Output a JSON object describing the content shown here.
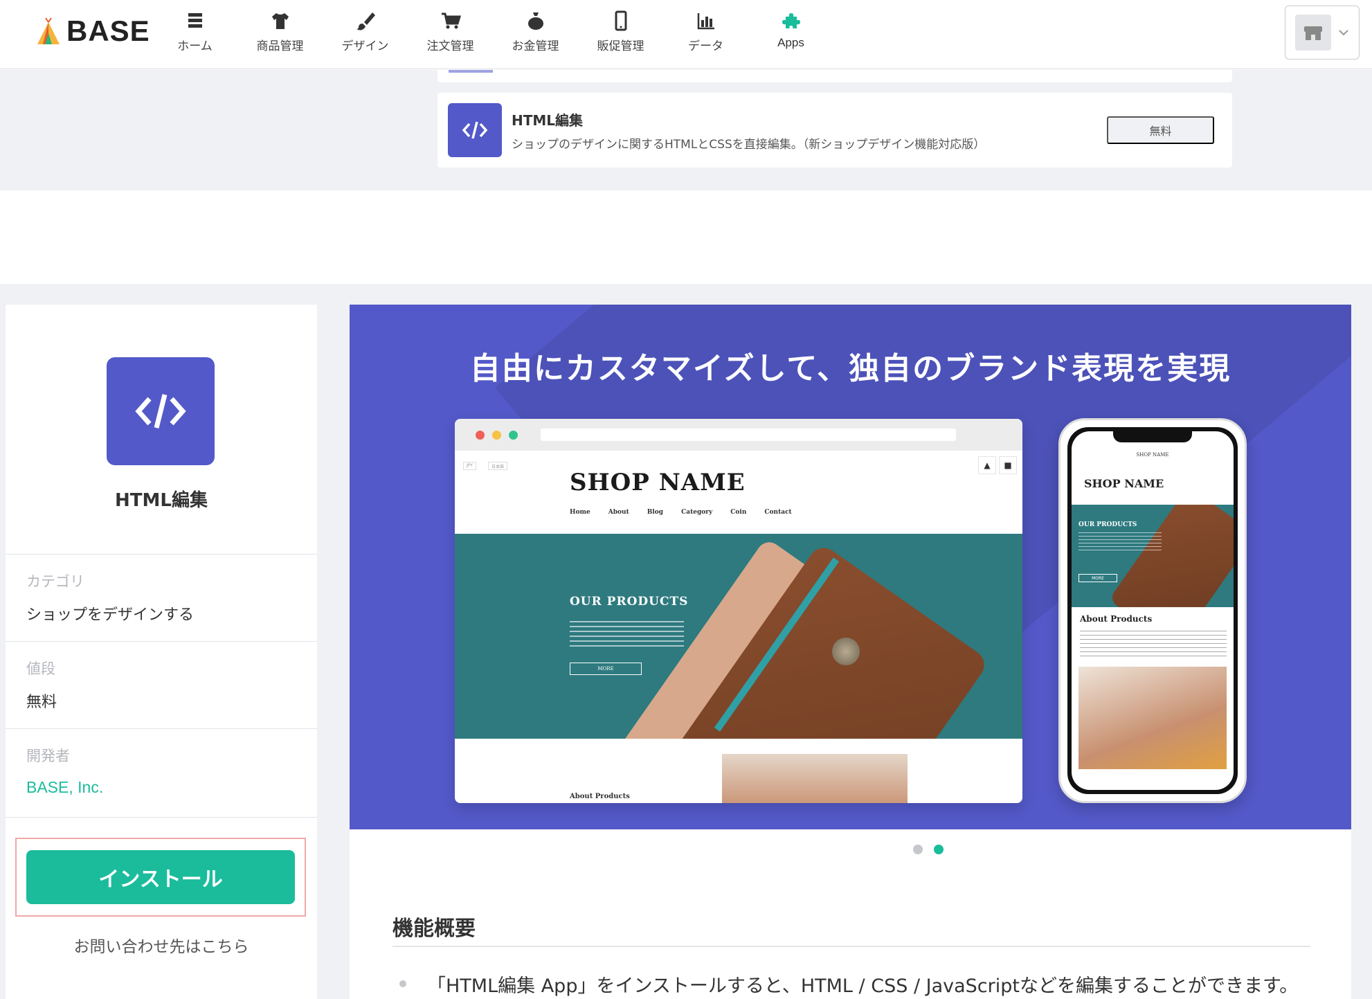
{
  "header": {
    "logo_text": "BASE",
    "nav": [
      {
        "label": "ホーム",
        "icon": "home-list-icon"
      },
      {
        "label": "商品管理",
        "icon": "tshirt-icon"
      },
      {
        "label": "デザイン",
        "icon": "brush-icon"
      },
      {
        "label": "注文管理",
        "icon": "cart-icon"
      },
      {
        "label": "お金管理",
        "icon": "money-bag-icon"
      },
      {
        "label": "販促管理",
        "icon": "smartphone-icon"
      },
      {
        "label": "データ",
        "icon": "bar-chart-icon"
      },
      {
        "label": "Apps",
        "icon": "puzzle-icon"
      }
    ]
  },
  "app_card": {
    "name": "HTML編集",
    "description": "ショップのデザインに関するHTMLとCSSを直接編集。（新ショップデザイン機能対応版）",
    "price_button": "無料"
  },
  "sidebar": {
    "app_name": "HTML編集",
    "category_label": "カテゴリ",
    "category_value": "ショップをデザインする",
    "price_label": "値段",
    "price_value": "無料",
    "developer_label": "開発者",
    "developer_value": "BASE, Inc.",
    "install_button": "インストール",
    "contact_link": "お問い合わせ先はこちら"
  },
  "hero": {
    "title": "自由にカスタマイズして、独自のブランド表現を実現",
    "browser": {
      "shop_name": "SHOP NAME",
      "nav": [
        "Home",
        "About",
        "Blog",
        "Category",
        "Coin",
        "Contact"
      ],
      "selects": [
        "JPY",
        "日本語"
      ],
      "our_products": "OUR PRODUCTS",
      "more": "MORE",
      "about_products": "About Products"
    },
    "phone": {
      "top_label": "SHOP NAME",
      "shop_name": "SHOP NAME",
      "our_products": "OUR PRODUCTS",
      "more": "MORE",
      "about_products": "About Products"
    },
    "active_slide": 2,
    "slide_count": 2
  },
  "features": {
    "title": "機能概要",
    "items": [
      "「HTML編集 App」をインストールすると、HTML / CSS / JavaScriptなどを編集することができます。"
    ]
  },
  "colors": {
    "accent": "#1abc9c",
    "brand_purple": "#5359c8"
  }
}
